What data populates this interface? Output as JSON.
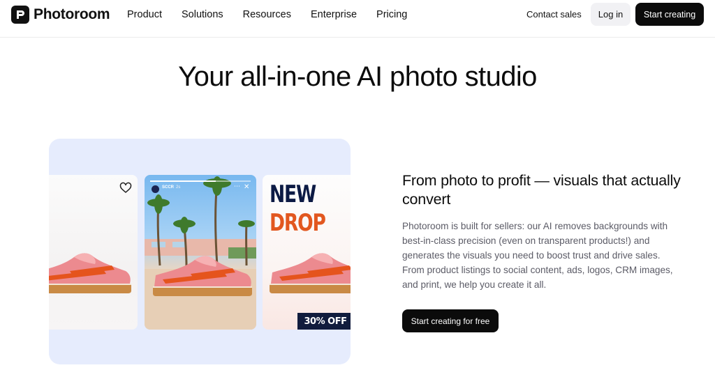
{
  "nav": {
    "brand": "Photoroom",
    "items": [
      {
        "label": "Product"
      },
      {
        "label": "Solutions"
      },
      {
        "label": "Resources"
      },
      {
        "label": "Enterprise"
      },
      {
        "label": "Pricing"
      }
    ],
    "contact_label": "Contact sales",
    "login_label": "Log in",
    "start_label": "Start creating"
  },
  "hero": {
    "title": "Your all-in-one AI photo studio"
  },
  "showcase": {
    "story_user": "SCCR",
    "story_time": "2s",
    "promo_line1": "NEW",
    "promo_line2": "DROP",
    "badge": "30% OFF"
  },
  "feature": {
    "title": "From photo to profit — visuals that actually convert",
    "body": "Photoroom is built for sellers: our AI removes backgrounds with best-in-class precision (even on transparent products!) and generates the visuals you need to boost trust and drive sales. From product listings to social content, ads, logos, CRM images, and print, we help you create it all.",
    "cta_label": "Start creating for free"
  },
  "colors": {
    "accent_dark": "#0b0b0b",
    "panel_bg": "#e6ecfd",
    "shoe_pink": "#ec8a8f",
    "stripe_orange": "#e5541d",
    "sole": "#c98a45"
  },
  "icons": [
    "photoroom-logo-icon",
    "heart-icon",
    "more-icon",
    "close-icon"
  ]
}
